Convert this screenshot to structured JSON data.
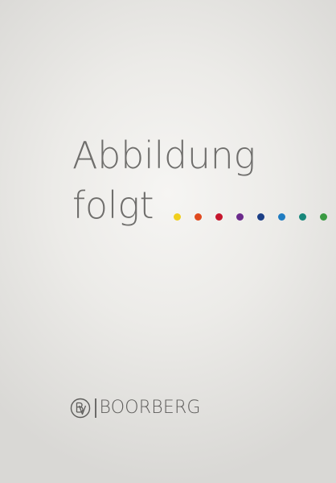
{
  "placeholder": {
    "line1": "Abbildung",
    "line2": "folgt"
  },
  "dots": [
    {
      "color": "#f0cf1e"
    },
    {
      "color": "#e04a1f"
    },
    {
      "color": "#c6162d"
    },
    {
      "color": "#6b2a8c"
    },
    {
      "color": "#1b3f86"
    },
    {
      "color": "#1f7cc1"
    },
    {
      "color": "#17877a"
    },
    {
      "color": "#3a9a42"
    }
  ],
  "logo": {
    "brand": "BOORBERG",
    "seal_icon": "bv-monogram-seal-icon"
  }
}
